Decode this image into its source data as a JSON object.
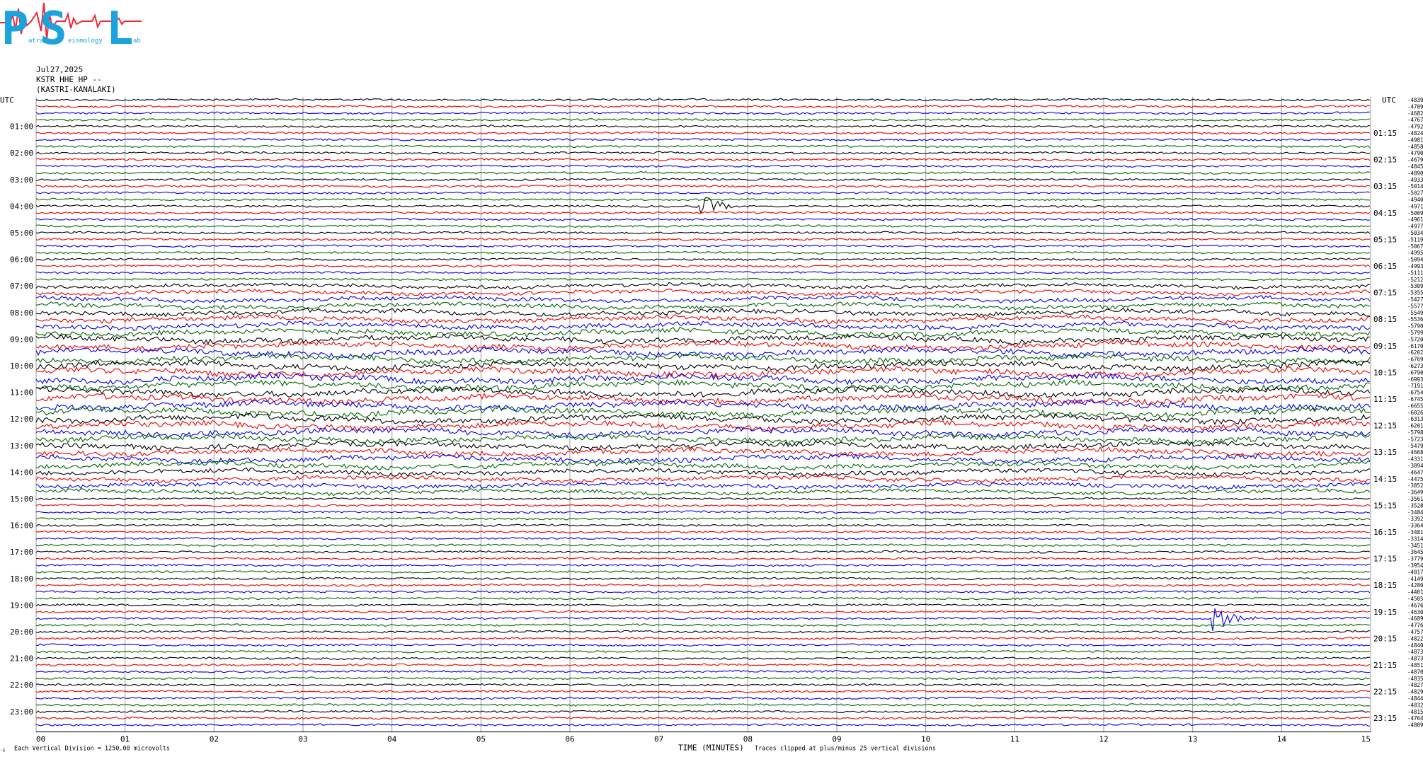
{
  "logo": {
    "letters": [
      "P",
      "S",
      "L"
    ],
    "words": [
      "atras",
      "eismology",
      "ab"
    ]
  },
  "header": {
    "date": "Jul27,2025",
    "station": "KSTR HHE HP --",
    "location": "(KASTRI-KANALAKI)"
  },
  "chart_data": {
    "type": "line",
    "description_note": "",
    "axis_left_label": "UTC",
    "axis_right_label": "UTC",
    "xlabel": "TIME (MINUTES)",
    "xlim": [
      0,
      15
    ],
    "x_ticks": [
      "00",
      "01",
      "02",
      "03",
      "04",
      "05",
      "06",
      "07",
      "08",
      "09",
      "10",
      "11",
      "12",
      "13",
      "14",
      "15"
    ],
    "left_hour_labels": [
      "01:00",
      "02:00",
      "03:00",
      "04:00",
      "05:00",
      "06:00",
      "07:00",
      "08:00",
      "09:00",
      "10:00",
      "11:00",
      "12:00",
      "13:00",
      "14:00",
      "15:00",
      "16:00",
      "17:00",
      "18:00",
      "19:00",
      "20:00",
      "21:00",
      "22:00",
      "23:00"
    ],
    "right_hour_labels": [
      "01:15",
      "02:15",
      "03:15",
      "04:15",
      "05:15",
      "06:15",
      "07:15",
      "08:15",
      "09:15",
      "10:15",
      "11:15",
      "12:15",
      "13:15",
      "14:15",
      "15:15",
      "16:15",
      "17:15",
      "18:15",
      "19:15",
      "20:15",
      "21:15",
      "22:15",
      "23:15"
    ],
    "trace_colors": [
      "#000000",
      "#ee0000",
      "#0000ee",
      "#006600"
    ],
    "trace_offsets": [
      -4839,
      -4709,
      -4682,
      -4767,
      -4792,
      -4824,
      -4981,
      -4858,
      -4790,
      -4679,
      -4845,
      -4890,
      -4933,
      -5014,
      -5027,
      -4940,
      -4971,
      -5069,
      -4961,
      -4977,
      -5034,
      -5119,
      -5067,
      -4995,
      -5094,
      -4993,
      -5111,
      -5212,
      -5309,
      -5355,
      -5427,
      -5577,
      -5549,
      -5536,
      -5790,
      -5799,
      -5720,
      -6170,
      -6202,
      -6769,
      -6273,
      -6790,
      -6993,
      -7191,
      -6754,
      -6745,
      -6655,
      -6026,
      -6313,
      -6201,
      -5798,
      -5723,
      -5479,
      -4668,
      -4331,
      -3894,
      -4647,
      -4475,
      -3852,
      -3649,
      -3561,
      -3528,
      -3484,
      -3392,
      -3364,
      -3481,
      -3314,
      -3451,
      -3645,
      -3779,
      -3954,
      -4017,
      -4149,
      -4280,
      -4401,
      -4505,
      -4676,
      -4630,
      -4689,
      -4776,
      -4757,
      -4822,
      -4840,
      -4873,
      -4873,
      -4851,
      -4870,
      -4835,
      -4827,
      -4829,
      -4844,
      -4832,
      -4815,
      -4764,
      -4809
    ],
    "events": [
      {
        "trace_hour": "04:00",
        "minute": 7.46
      },
      {
        "trace_hour": "19:30",
        "minute": 13.22
      }
    ],
    "footer_left": "Each Vertical Division = 1250.00 microvolts",
    "footer_right": "Traces clipped at plus/minus 25 vertical divisions",
    "corner_mark": "·S"
  }
}
